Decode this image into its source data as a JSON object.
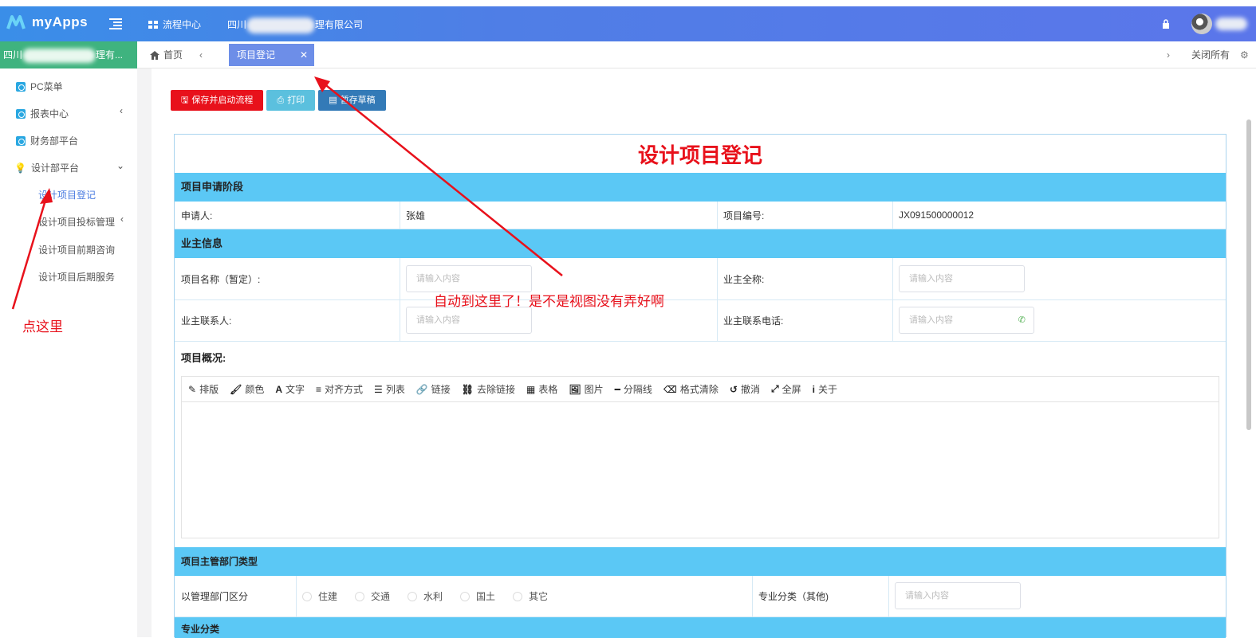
{
  "app": {
    "name": "myApps"
  },
  "topbar": {
    "nav_item": "流程中心",
    "company_prefix": "四川",
    "company_suffix": "理有限公司"
  },
  "tabs": {
    "org_prefix": "四川",
    "org_suffix": "理有...",
    "home": "首页",
    "active": "项目登记",
    "close_all": "关闭所有"
  },
  "sidebar": {
    "items": [
      {
        "label": "PC菜单"
      },
      {
        "label": "报表中心"
      },
      {
        "label": "财务部平台"
      },
      {
        "label": "设计部平台"
      }
    ],
    "subitems": [
      {
        "label": "设计项目登记"
      },
      {
        "label": "设计项目投标管理"
      },
      {
        "label": "设计项目前期咨询"
      },
      {
        "label": "设计项目后期服务"
      }
    ]
  },
  "buttons": {
    "save_start": "保存并启动流程",
    "print": "打印",
    "save_draft": "暂存草稿"
  },
  "form": {
    "title": "设计项目登记",
    "section_apply": "项目申请阶段",
    "applicant_label": "申请人:",
    "applicant_value": "张雄",
    "project_no_label": "项目编号:",
    "project_no_value": "JX091500000012",
    "section_owner": "业主信息",
    "project_name_label": "项目名称（暂定）:",
    "owner_fullname_label": "业主全称:",
    "owner_contact_label": "业主联系人:",
    "owner_phone_label": "业主联系电话:",
    "placeholder": "请输入内容",
    "overview_label": "项目概况:",
    "section_dept": "项目主管部门类型",
    "dept_label": "以管理部门区分",
    "radios": [
      "住建",
      "交通",
      "水利",
      "国土",
      "其它"
    ],
    "specialty_other_label": "专业分类（其他)",
    "section_specialty": "专业分类"
  },
  "editor_toolbar": [
    {
      "icon": "pencil-icon",
      "glyph": "✎",
      "label": "排版"
    },
    {
      "icon": "brush-icon",
      "glyph": "🖌",
      "label": "颜色"
    },
    {
      "icon": "text-icon",
      "glyph": "A",
      "label": "文字"
    },
    {
      "icon": "align-icon",
      "glyph": "≡",
      "label": "对齐方式"
    },
    {
      "icon": "list-icon",
      "glyph": "☰",
      "label": "列表"
    },
    {
      "icon": "link-icon",
      "glyph": "🔗",
      "label": "链接"
    },
    {
      "icon": "unlink-icon",
      "glyph": "⛓",
      "label": "去除链接"
    },
    {
      "icon": "table-icon",
      "glyph": "▦",
      "label": "表格"
    },
    {
      "icon": "image-icon",
      "glyph": "🖼",
      "label": "图片"
    },
    {
      "icon": "divider-icon",
      "glyph": "━",
      "label": "分隔线"
    },
    {
      "icon": "eraser-icon",
      "glyph": "⌫",
      "label": "格式清除"
    },
    {
      "icon": "undo-icon",
      "glyph": "↺",
      "label": "撤消"
    },
    {
      "icon": "fullscreen-icon",
      "glyph": "⤢",
      "label": "全屏"
    },
    {
      "icon": "info-icon",
      "glyph": "i",
      "label": "关于"
    }
  ],
  "annotations": {
    "click_here": "点这里",
    "auto_jump": "自动到这里了！是不是视图没有弄好啊"
  },
  "colors": {
    "accent": "#5b76ea",
    "danger": "#e8111b",
    "section": "#5bc8f5"
  }
}
